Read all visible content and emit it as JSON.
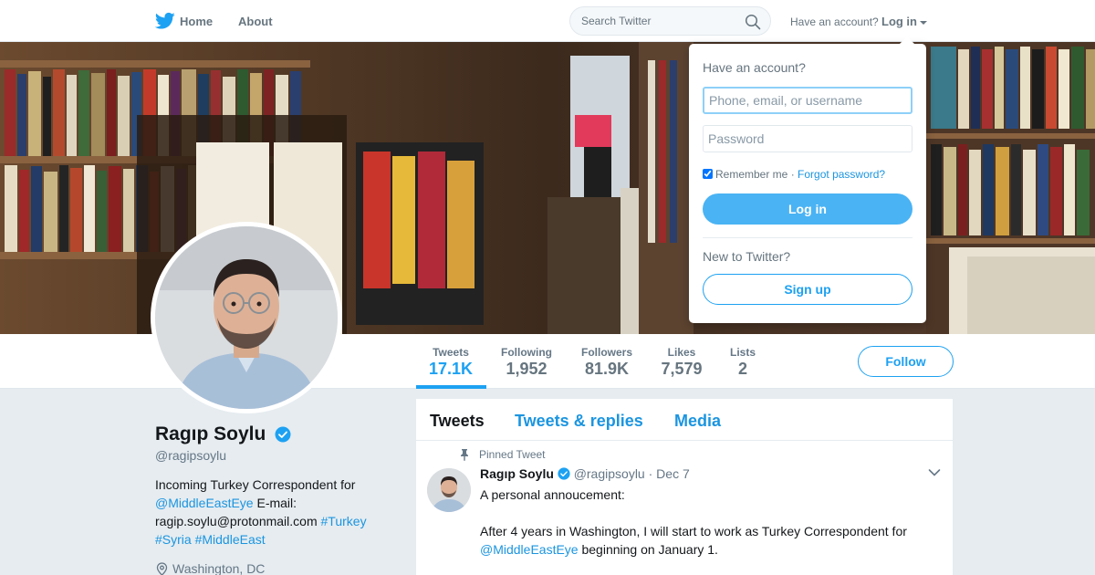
{
  "nav": {
    "brand_icon": "twitter-bird-icon",
    "home_label": "Home",
    "about_label": "About",
    "search_placeholder": "Search Twitter",
    "have_account": "Have an account?",
    "login_label": "Log in",
    "accent": "#1da1f2"
  },
  "stats": [
    {
      "label": "Tweets",
      "value": "17.1K",
      "active": true
    },
    {
      "label": "Following",
      "value": "1,952"
    },
    {
      "label": "Followers",
      "value": "81.9K"
    },
    {
      "label": "Likes",
      "value": "7,579"
    },
    {
      "label": "Lists",
      "value": "2"
    }
  ],
  "follow_label": "Follow",
  "profile": {
    "name": "Ragıp Soylu",
    "handle": "@ragipsoylu",
    "bio_line1": "Incoming Turkey Correspondent for",
    "bio_link1": "@MiddleEastEye",
    "bio_text2": " E-mail:",
    "bio_email": "ragip.soylu@protonmail.com",
    "bio_tag1": "#Turkey",
    "bio_tag2": "#Syria",
    "bio_tag3": "#MiddleEast",
    "location": "Washington, DC"
  },
  "timeline": {
    "tabs": [
      "Tweets",
      "Tweets & replies",
      "Media"
    ],
    "pinned_label": "Pinned Tweet",
    "tweet": {
      "name": "Ragıp Soylu",
      "handle": "@ragipsoylu",
      "sep": "·",
      "date": "Dec 7",
      "line1": "A personal annoucement:",
      "line2": "After 4 years in Washington, I will start to work as Turkey Correspondent for",
      "link": "@MiddleEastEye",
      "line3": " beginning on January 1."
    }
  },
  "login_dropdown": {
    "title": "Have an account?",
    "user_placeholder": "Phone, email, or username",
    "password_placeholder": "Password",
    "remember": "Remember me",
    "dot": "·",
    "forgot": "Forgot password?",
    "login_button": "Log in",
    "new_label": "New to Twitter?",
    "signup_button": "Sign up"
  }
}
